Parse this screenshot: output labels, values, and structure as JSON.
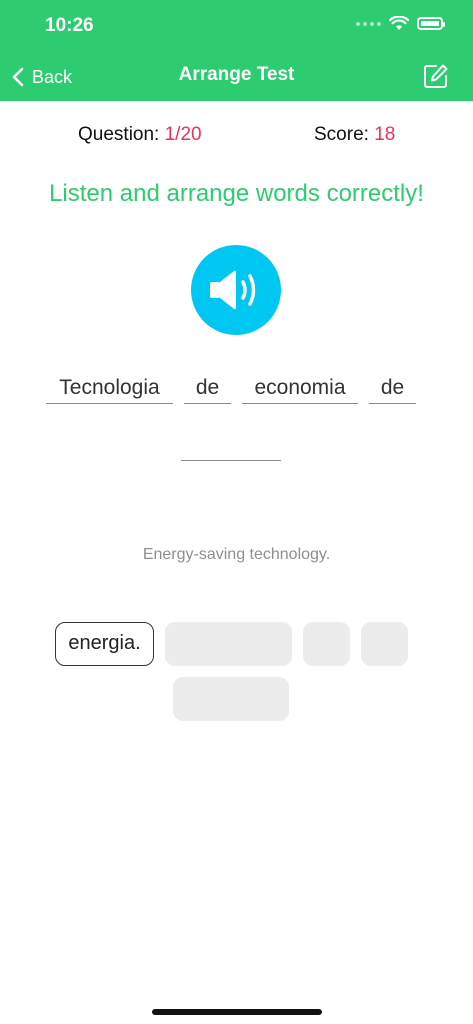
{
  "status_bar": {
    "time": "10:26"
  },
  "nav": {
    "back_label": "Back",
    "title": "Arrange Test"
  },
  "progress": {
    "question_label": "Question: ",
    "question_value": "1/20",
    "score_label": "Score: ",
    "score_value": "18"
  },
  "instruction": "Listen and arrange words correctly!",
  "answer_slots": [
    "Tecnologia",
    "de",
    "economia",
    "de",
    ""
  ],
  "translation": "Energy-saving technology.",
  "word_bank": [
    "energia.",
    "",
    "",
    "",
    ""
  ],
  "colors": {
    "accent": "#2ecc71",
    "highlight": "#e8345a",
    "speaker": "#00c7f2"
  }
}
